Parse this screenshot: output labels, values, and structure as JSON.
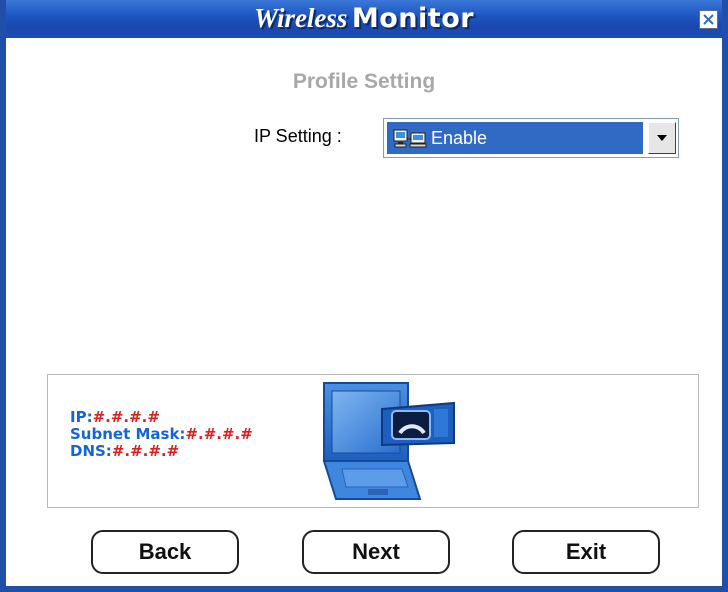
{
  "window": {
    "title_part1": "Wireless",
    "title_part2": "Monitor",
    "close_icon": "close-icon"
  },
  "page": {
    "heading": "Profile Setting"
  },
  "ip_setting": {
    "label": "IP Setting :",
    "selected": "Enable",
    "icon": "network-icon"
  },
  "info": {
    "ip_label": "IP:",
    "ip_value": "#.#.#.#",
    "subnet_label": "Subnet Mask:",
    "subnet_value": "#.#.#.#",
    "dns_label": "DNS:",
    "dns_value": "#.#.#.#"
  },
  "buttons": {
    "back": "Back",
    "next": "Next",
    "exit": "Exit"
  },
  "colors": {
    "title_bar": "#1f56c4",
    "selection": "#316ac5",
    "info_label": "#1565d8",
    "info_value": "#e02020"
  }
}
